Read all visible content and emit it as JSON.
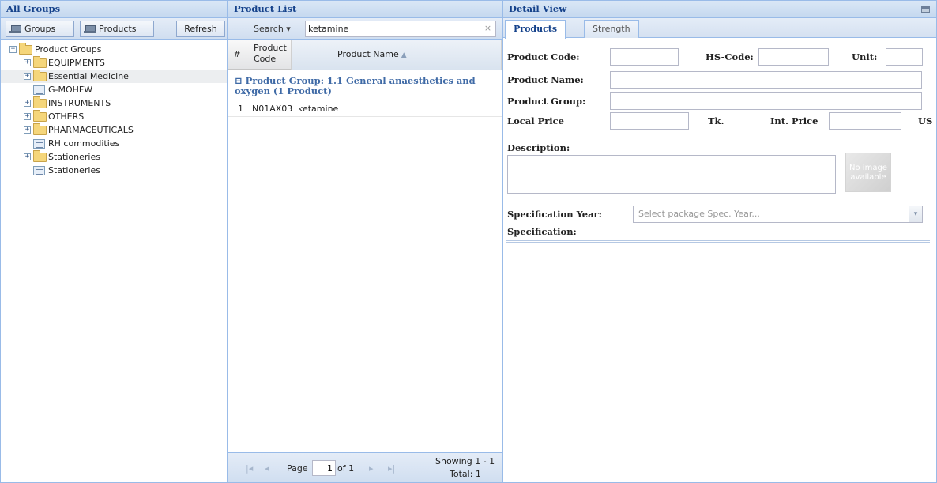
{
  "left_panel": {
    "title": "All Groups",
    "toolbar": {
      "groups_label": "Groups",
      "products_label": "Products",
      "refresh_label": "Refresh"
    },
    "tree": {
      "root_label": "Product Groups",
      "items": [
        {
          "label": "EQUIPMENTS",
          "type": "folder"
        },
        {
          "label": "Essential Medicine",
          "type": "folder"
        },
        {
          "label": "G-MOHFW",
          "type": "leaf"
        },
        {
          "label": "INSTRUMENTS",
          "type": "folder"
        },
        {
          "label": "OTHERS",
          "type": "folder"
        },
        {
          "label": "PHARMACEUTICALS",
          "type": "folder"
        },
        {
          "label": "RH commodities",
          "type": "leaf"
        },
        {
          "label": "Stationeries",
          "type": "folder"
        },
        {
          "label": "Stationeries",
          "type": "leaf"
        }
      ]
    }
  },
  "middle_panel": {
    "title": "Product List",
    "search": {
      "label": "Search ▾",
      "value": "ketamine",
      "clear_symbol": "×"
    },
    "columns": {
      "num": "#",
      "code": "Product Code",
      "name": "Product Name"
    },
    "group_header": "⊟ Product Group: 1.1 General anaesthetics and oxygen (1 Product)",
    "rows": [
      {
        "num": "1",
        "code": "N01AX03",
        "name": "ketamine"
      }
    ],
    "pager": {
      "page_label": "Page",
      "page_value": "1",
      "of_label": "of 1",
      "showing": "Showing 1 - 1",
      "total": "Total: 1"
    }
  },
  "right_panel": {
    "title": "Detail View",
    "tabs": [
      {
        "label": "Products",
        "active": true
      },
      {
        "label": "Strength",
        "active": false
      }
    ],
    "labels": {
      "product_code": "Product Code:",
      "hs_code": "HS-Code:",
      "unit": "Unit:",
      "product_name": "Product Name:",
      "product_group": "Product Group:",
      "local_price": "Local Price",
      "tk": "Tk.",
      "int_price": "Int. Price",
      "us": "US",
      "description": "Description:",
      "spec_year": "Specification Year:",
      "specification": "Specification:"
    },
    "no_image_text": "No image available",
    "spec_year_placeholder": "Select package Spec. Year..."
  }
}
